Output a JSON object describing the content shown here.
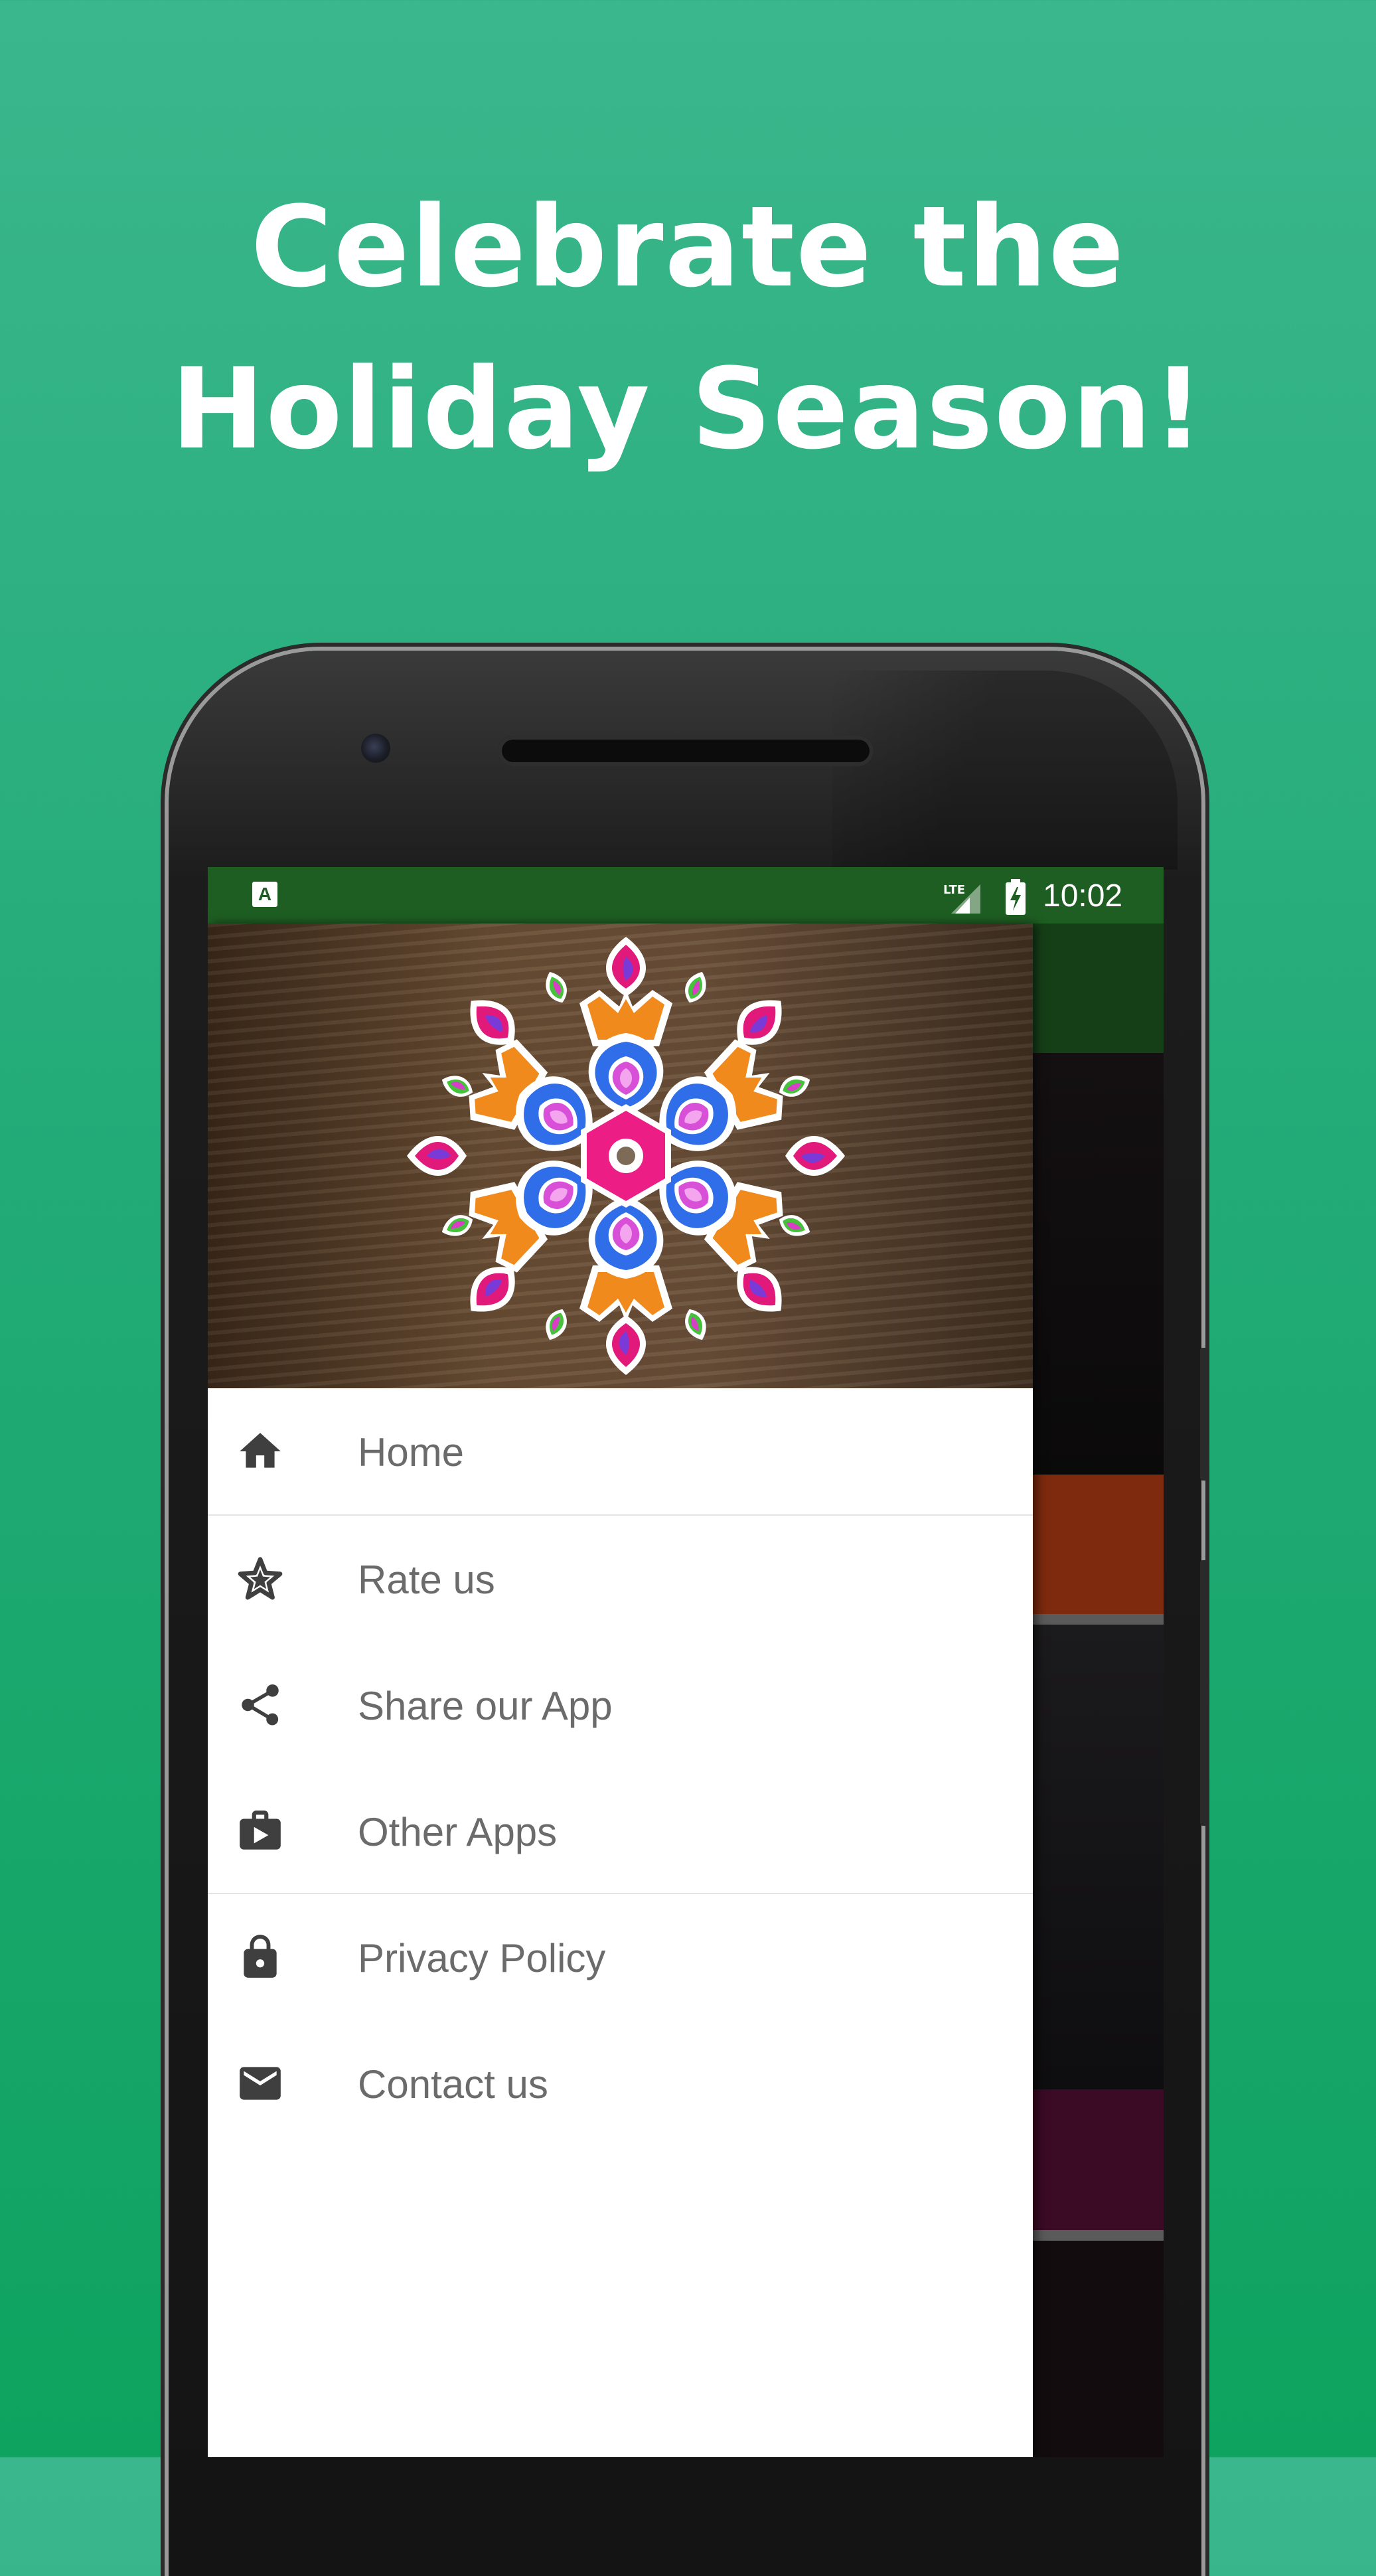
{
  "promo": {
    "line1": "Celebrate the",
    "line2": "Holiday Season!"
  },
  "status_bar": {
    "time": "10:02",
    "left_icon": "A",
    "network_label": "LTE",
    "colors": {
      "background": "#1e5e22"
    }
  },
  "drawer": {
    "header_image": "rangoli-image",
    "items": [
      {
        "label": "Home",
        "icon": "home-icon"
      },
      {
        "label": "Rate us",
        "icon": "star-icon"
      },
      {
        "label": "Share our App",
        "icon": "share-icon"
      },
      {
        "label": "Other Apps",
        "icon": "play-store-bag-icon"
      },
      {
        "label": "Privacy Policy",
        "icon": "lock-icon"
      },
      {
        "label": "Contact us",
        "icon": "mail-icon"
      }
    ]
  },
  "colors": {
    "background_top": "#3bb78d",
    "background_bottom": "#0ea35f",
    "menu_text": "#6b6b6b",
    "icon": "#3f3f3f"
  }
}
